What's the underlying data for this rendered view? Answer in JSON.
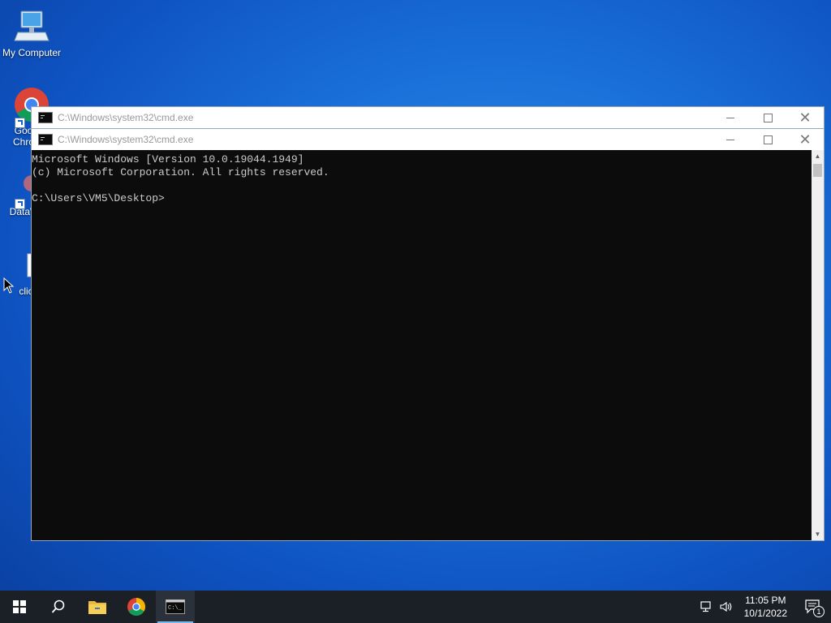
{
  "desktop": {
    "icons": [
      {
        "label": "My Computer"
      },
      {
        "label": "Goo\nChro"
      },
      {
        "label": "DataW"
      },
      {
        "label": "clic"
      }
    ]
  },
  "windows": {
    "back": {
      "title": "C:\\Windows\\system32\\cmd.exe"
    },
    "front": {
      "title": "C:\\Windows\\system32\\cmd.exe"
    }
  },
  "console": {
    "lines": [
      "Microsoft Windows [Version 10.0.19044.1949]",
      "(c) Microsoft Corporation. All rights reserved.",
      "",
      "C:\\Users\\VM5\\Desktop>"
    ]
  },
  "taskbar": {
    "time": "11:05 PM",
    "date": "10/1/2022",
    "notification_count": "1"
  },
  "colors": {
    "console_bg": "#0c0c0c",
    "console_fg": "#cccccc",
    "taskbar_bg": "#1b1f26",
    "active_indicator": "#76b9ed"
  }
}
